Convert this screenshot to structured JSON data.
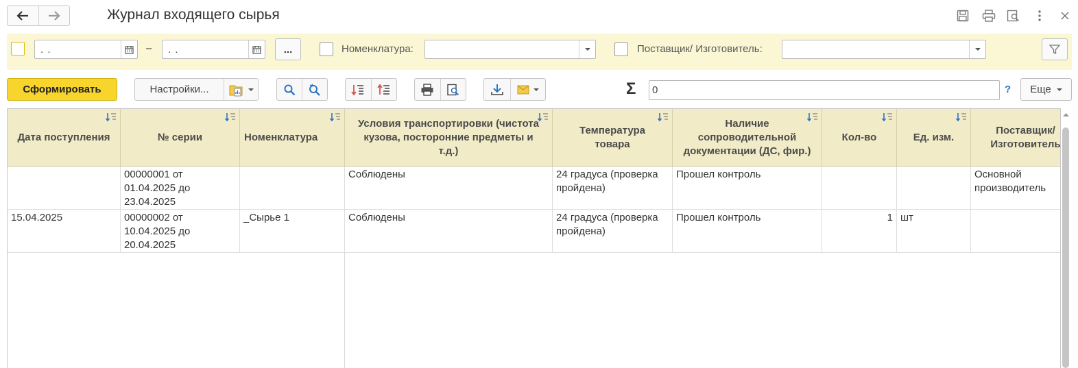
{
  "window": {
    "title": "Журнал входящего сырья"
  },
  "filters": {
    "date_from": ".  .",
    "date_to": ".  .",
    "dash": "–",
    "more_label": "...",
    "nomenclature_label": "Номенклатура:",
    "nomenclature_value": "",
    "supplier_label": "Поставщик/ Изготовитель:",
    "supplier_value": ""
  },
  "toolbar": {
    "generate_label": "Сформировать",
    "settings_label": "Настройки...",
    "sigma": "Σ",
    "sum_value": "0",
    "help_label": "?",
    "more_label": "Еще"
  },
  "table": {
    "columns": [
      "Дата поступления",
      "№ серии",
      "Номенклатура",
      "Условия транспортировки (чистота кузова, посторонние предметы и т.д.)",
      "Температура товара",
      "Наличие сопроводительной документации (ДС, фир.)",
      "Кол-во",
      "Ед. изм.",
      "Поставщик/ Изготовитель"
    ],
    "rows": [
      {
        "date": "",
        "series": "00000001 от 01.04.2025 до 23.04.2025",
        "nomenclature": "",
        "transport": "Соблюдены",
        "temperature": "24 градуса (проверка пройдена)",
        "documents": "Прошел контроль",
        "qty": "",
        "unit": "",
        "supplier": "Основной производитель"
      },
      {
        "date": "15.04.2025",
        "series": "00000002 от 10.04.2025 до 20.04.2025",
        "nomenclature": "_Сырье 1",
        "transport": "Соблюдены",
        "temperature": "24 градуса (проверка пройдена)",
        "documents": "Прошел контроль",
        "qty": "1",
        "unit": "шт",
        "supplier": ""
      }
    ]
  }
}
